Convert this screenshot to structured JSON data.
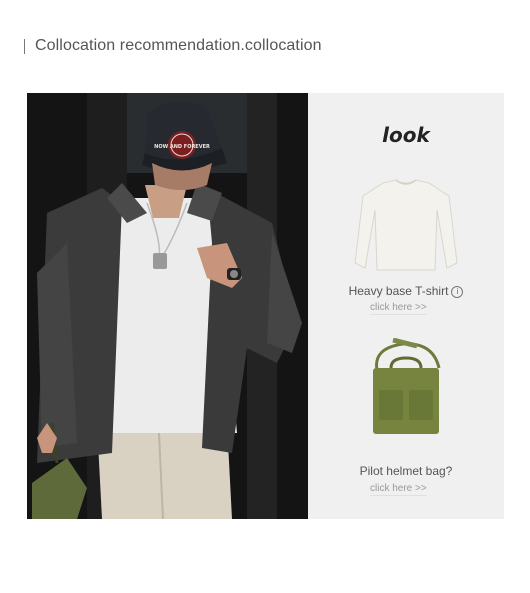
{
  "header": {
    "title": "Collocation recommendation.collocation"
  },
  "photo": {
    "cap_badge_text": "NOW AND FOREVER"
  },
  "panel": {
    "look_label": "look",
    "products": [
      {
        "title": "Heavy base T-shirt",
        "info_icon": "i",
        "link": "click here >>"
      },
      {
        "title": "Pilot helmet bag?",
        "link": "click here >>"
      }
    ]
  },
  "colors": {
    "panel_bg": "#f0f0f0",
    "photo_bg": "#181818",
    "bag_green": "#6f7f3f"
  }
}
